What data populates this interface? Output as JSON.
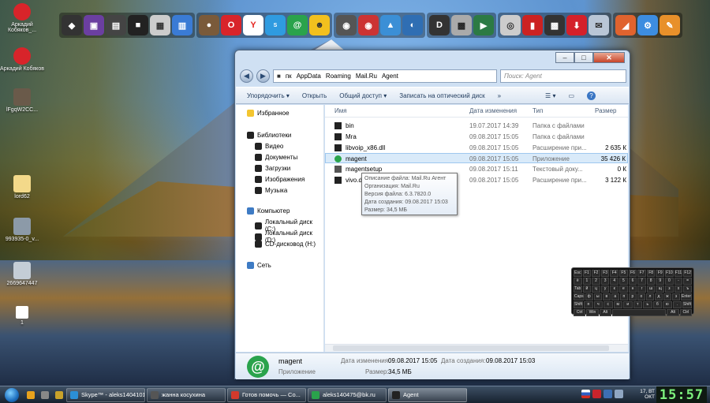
{
  "desktop_icons": [
    {
      "label": "Аркадий Кобяков_..."
    },
    {
      "label": "Аркадий Кобяков"
    },
    {
      "label": "lFgqW2CC..."
    },
    {
      "label": "lord62"
    },
    {
      "label": "993935-0_v..."
    },
    {
      "label": "2669647447"
    },
    {
      "label": "1"
    }
  ],
  "window": {
    "address": {
      "crumbs": [
        "пк",
        "AppData",
        "Roaming",
        "Mail.Ru",
        "Agent"
      ],
      "search_placeholder": "Поиск: Agent"
    },
    "commands": [
      "Упорядочить ▾",
      "Открыть",
      "Общий доступ ▾",
      "Записать на оптический диск",
      "»"
    ],
    "nav": {
      "favorites": "Избранное",
      "libraries": "Библиотеки",
      "library_items": [
        "Видео",
        "Документы",
        "Загрузки",
        "Изображения",
        "Музыка"
      ],
      "computer": "Компьютер",
      "drives": [
        "Локальный диск (C:)",
        "Локальный диск (D:)",
        "CD-дисковод (H:)"
      ],
      "network": "Сеть"
    },
    "columns": {
      "name": "Имя",
      "date": "Дата изменения",
      "type": "Тип",
      "size": "Размер"
    },
    "files": [
      {
        "name": "bin",
        "date": "19.07.2017 14:39",
        "type": "Папка с файлами",
        "size": ""
      },
      {
        "name": "Mra",
        "date": "09.08.2017 15:05",
        "type": "Папка с файлами",
        "size": ""
      },
      {
        "name": "libvoip_x86.dll",
        "date": "09.08.2017 15:05",
        "type": "Расширение при...",
        "size": "2 635 К"
      },
      {
        "name": "magent",
        "date": "09.08.2017 15:05",
        "type": "Приложение",
        "size": "35 426 К"
      },
      {
        "name": "magentsetup",
        "date": "09.08.2017 15:11",
        "type": "Текстовый доку...",
        "size": "0 К"
      },
      {
        "name": "vivo.d",
        "date": "09.08.2017 15:05",
        "type": "Расширение при...",
        "size": "3 122 К"
      }
    ],
    "tooltip": [
      "Описание файла: Mail.Ru Агент",
      "Организация: Mail.Ru",
      "Версия файла: 6.3.7820.0",
      "Дата создания: 09.08.2017 15:03",
      "Размер: 34,5 МБ"
    ],
    "details": {
      "name": "magent",
      "kind": "Приложение",
      "modified_label": "Дата изменения:",
      "modified": "09.08.2017 15:05",
      "size_label": "Размер:",
      "size": "34,5 МБ",
      "created_label": "Дата создания:",
      "created": "09.08.2017 15:03"
    }
  },
  "taskbar": {
    "buttons": [
      {
        "label": "Skype™ - aleks1404101",
        "color": "#2b8fd6"
      },
      {
        "label": "жанна косухина",
        "color": "#555555"
      },
      {
        "label": "Готов помочь — Со...",
        "color": "#d13a2c"
      },
      {
        "label": "aleks140475@bk.ru",
        "color": "#2aa34c"
      },
      {
        "label": "Agent",
        "color": "#222222"
      }
    ],
    "date_line1": "17, ВТ",
    "date_line2": "ОКТ",
    "clock": "15:57"
  },
  "keyboard": {
    "rows": [
      [
        "Esc",
        "F1",
        "F2",
        "F3",
        "F4",
        "F5",
        "F6",
        "F7",
        "F8",
        "F9",
        "F10",
        "F11",
        "F12"
      ],
      [
        "ё",
        "1",
        "2",
        "3",
        "4",
        "5",
        "6",
        "7",
        "8",
        "9",
        "0",
        "-",
        "="
      ],
      [
        "Tab",
        "й",
        "ц",
        "у",
        "к",
        "е",
        "н",
        "г",
        "ш",
        "щ",
        "з",
        "х",
        "ъ"
      ],
      [
        "Caps",
        "ф",
        "ы",
        "в",
        "а",
        "п",
        "р",
        "о",
        "л",
        "д",
        "ж",
        "э",
        "Enter"
      ],
      [
        "Shift",
        "я",
        "ч",
        "с",
        "м",
        "и",
        "т",
        "ь",
        "б",
        "ю",
        ".",
        "Shift"
      ],
      [
        "Ctrl",
        "Win",
        "Alt",
        "",
        "Alt",
        "Ctrl"
      ]
    ]
  }
}
